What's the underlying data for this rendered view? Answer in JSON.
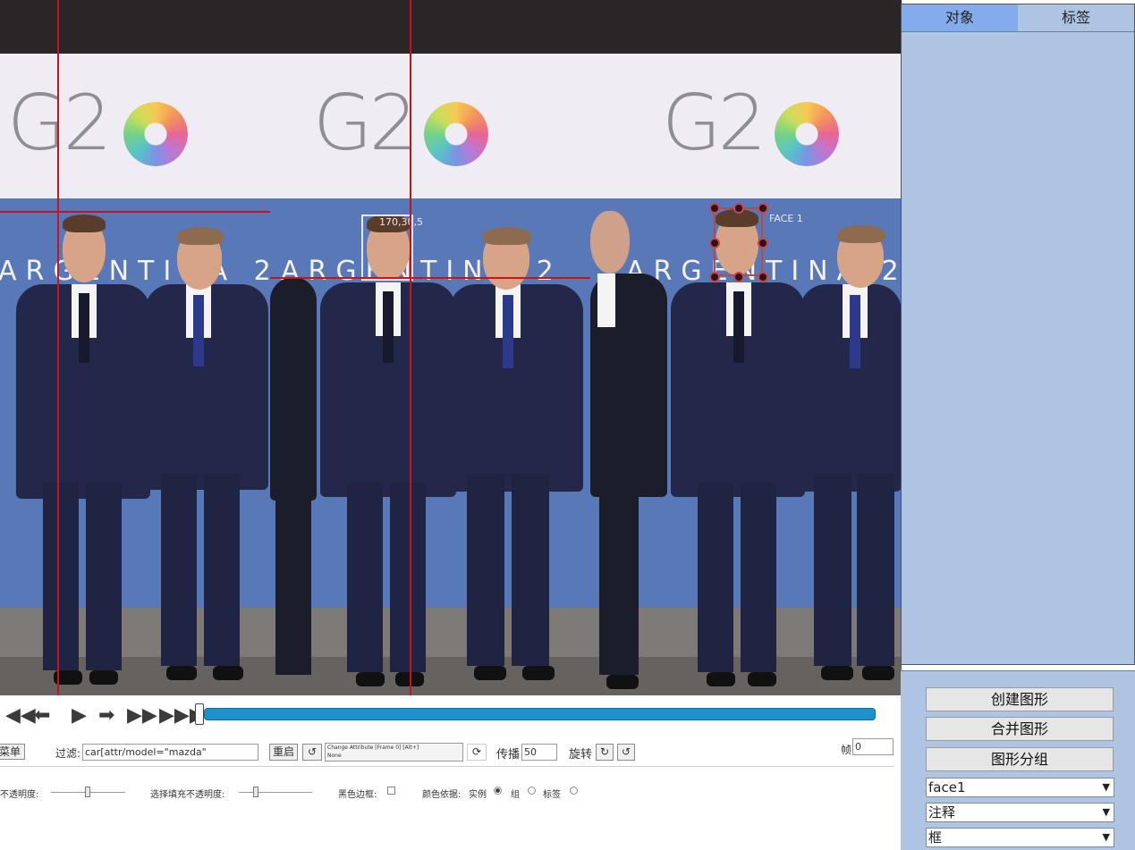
{
  "sidebar": {
    "tabs": [
      {
        "label": "对象",
        "active": true
      },
      {
        "label": "标签",
        "active": false
      }
    ]
  },
  "actions": {
    "create_shape": "创建图形",
    "merge_shapes": "合并图形",
    "group_shapes": "图形分组"
  },
  "selects": {
    "object_label": "face1",
    "mode": "注释",
    "shape_type": "框"
  },
  "stage": {
    "logo_text": "G2",
    "banner_text": "ARGENTINA 2",
    "bbox_label_1": "170,30,5",
    "bbox_label_2": "FACE 1"
  },
  "player": {
    "icons": [
      "fast-backward-icon",
      "step-backward-icon",
      "play-icon",
      "step-forward-icon",
      "fast-forward-icon",
      "to-end-icon"
    ],
    "progress": 0.0
  },
  "controls": {
    "menu_label": "菜单",
    "filter_label": "过滤:",
    "filter_value": "car[attr/model=\"mazda\"",
    "reset_label": "重启",
    "attribute_line1": "Change Attribute [Frame 0] [Alt+]",
    "attribute_line2": "None",
    "propagate_label": "传播",
    "propagate_value": "50",
    "rotate_label": "旋转",
    "frame_label": "帧",
    "frame_value": "0"
  },
  "appearance": {
    "opacity_label": "不透明度:",
    "selected_fill_label": "选择填充不透明度:",
    "black_border_label": "黑色边框:",
    "color_by_label": "颜色依据:",
    "color_options": [
      {
        "label": "实例",
        "checked": true
      },
      {
        "label": "组",
        "checked": false
      },
      {
        "label": "标签",
        "checked": false
      }
    ]
  },
  "colors": {
    "accent_tab": "#84abeb",
    "sidebar_bg": "#aec4e3",
    "progress": "#1f91cb",
    "grid_line": "#c4141c"
  }
}
